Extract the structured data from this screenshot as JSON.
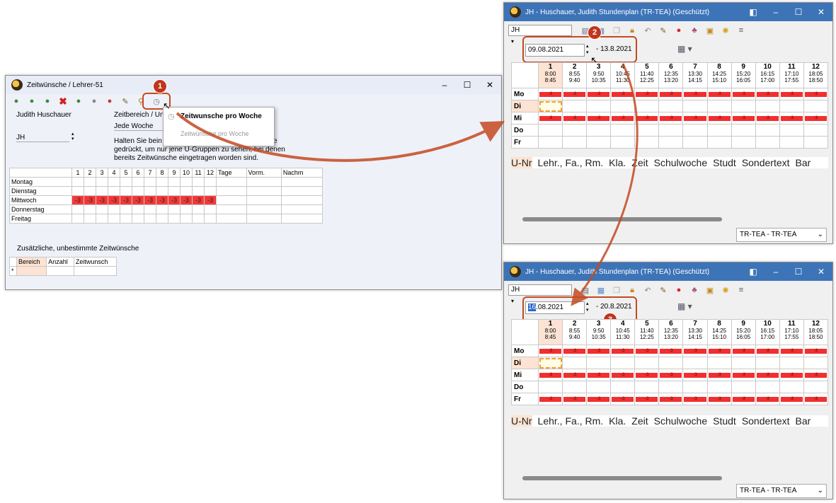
{
  "win1": {
    "title": "Zeitwünsche / Lehrer-51",
    "teacher_name": "Judith Huschauer",
    "teacher_code": "JH",
    "zeitbereich_label": "Zeitbereich / Un",
    "zeitbereich_value": "Jede Woche",
    "help_text_1": "Halten Sie bein",
    "help_text_2": "gedrückt, um nur jene U-Gruppen zu sehen, bei denen",
    "help_text_3": "bereits Zeitwünsche eingetragen worden sind.",
    "help_suffix": "e",
    "periods": [
      "1",
      "2",
      "3",
      "4",
      "5",
      "6",
      "7",
      "8",
      "9",
      "10",
      "11",
      "12"
    ],
    "extra_cols": [
      "Tage",
      "Vorm.",
      "Nachm"
    ],
    "days": [
      "Montag",
      "Dienstag",
      "Mittwoch",
      "Donnerstag",
      "Freitag"
    ],
    "neg_value": "-3",
    "extra_title": "Zusätzliche, unbestimmte Zeitwünsche",
    "extra_headers": [
      "Bereich",
      "Anzahl",
      "Zeitwunsch"
    ],
    "row_marker": "*",
    "popup_title": "Zeitwunsche pro Woche",
    "popup_sub": "Zeitwünsche pro Woche",
    "badge": "1"
  },
  "win2": {
    "title": "JH - Huschauer, Judith  Stundenplan  (TR-TEA) (Geschützt)",
    "element": "JH",
    "date_from": "09.08.2021",
    "date_to": "- 13.8.2021",
    "badge": "2"
  },
  "win3": {
    "title": "JH - Huschauer, Judith  Stundenplan  (TR-TEA) (Geschützt)",
    "element": "JH",
    "date_from_hl": "16",
    "date_from_rest": ".08.2021",
    "date_to": "- 20.8.2021",
    "badge": "3"
  },
  "timetable": {
    "periods": [
      "1",
      "2",
      "3",
      "4",
      "5",
      "6",
      "7",
      "8",
      "9",
      "10",
      "11",
      "12"
    ],
    "starts": [
      "8:00",
      "8:55",
      "9:50",
      "10:45",
      "11:40",
      "12:35",
      "13:30",
      "14:25",
      "15:20",
      "16:15",
      "17:10",
      "18:05"
    ],
    "ends": [
      "8:45",
      "9:40",
      "10:35",
      "11:30",
      "12:25",
      "13:20",
      "14:15",
      "15:10",
      "16:05",
      "17:00",
      "17:55",
      "18:50"
    ],
    "days": [
      "Mo",
      "Di",
      "Mi",
      "Do",
      "Fr"
    ],
    "cell_value": "-3",
    "columns": [
      "U-Nr",
      "Lehr., Fa., Rm.",
      "Kla.",
      "Zeit",
      "Schulwoche",
      "Studt",
      "Sondertext",
      "Bar"
    ],
    "status_combo": "TR-TEA - TR-TEA"
  },
  "colors": {
    "accent": "#3d74b8",
    "negative": "#f22e2e",
    "callout": "#c44a22"
  }
}
